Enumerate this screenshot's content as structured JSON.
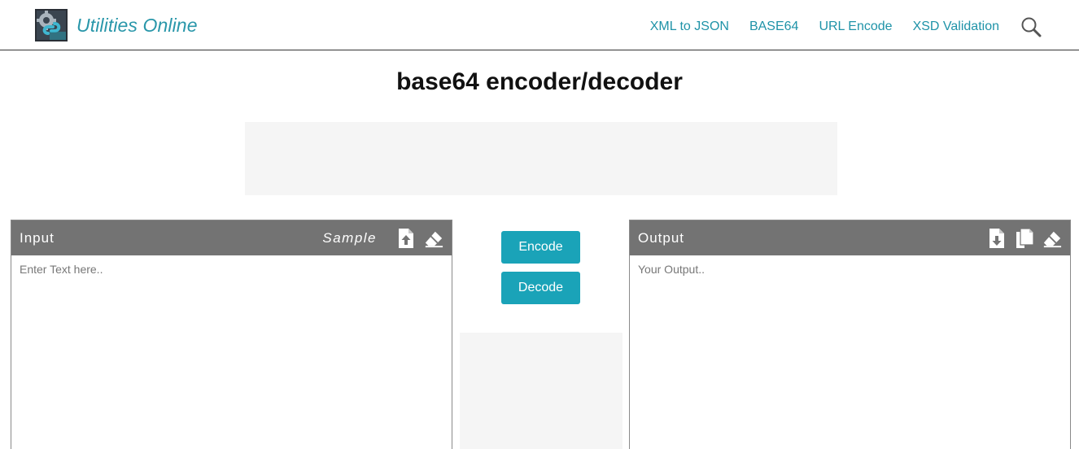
{
  "header": {
    "brand_name": "Utilities Online",
    "nav": [
      {
        "label": "XML to JSON"
      },
      {
        "label": "BASE64"
      },
      {
        "label": "URL Encode"
      },
      {
        "label": "XSD Validation"
      }
    ],
    "search_icon": "search-icon"
  },
  "page": {
    "title": "base64 encoder/decoder"
  },
  "input_panel": {
    "title": "Input",
    "sample_label": "Sample",
    "placeholder": "Enter Text here..",
    "icons": [
      "upload-file-icon",
      "eraser-icon"
    ]
  },
  "actions": {
    "encode_label": "Encode",
    "decode_label": "Decode"
  },
  "output_panel": {
    "title": "Output",
    "placeholder": "Your Output..",
    "icons": [
      "download-file-icon",
      "copy-icon",
      "eraser-icon"
    ]
  },
  "colors": {
    "accent": "#1aa3b8",
    "link": "#1f93a8",
    "panel_bar": "#737373",
    "ad_placeholder": "#f5f5f5"
  }
}
